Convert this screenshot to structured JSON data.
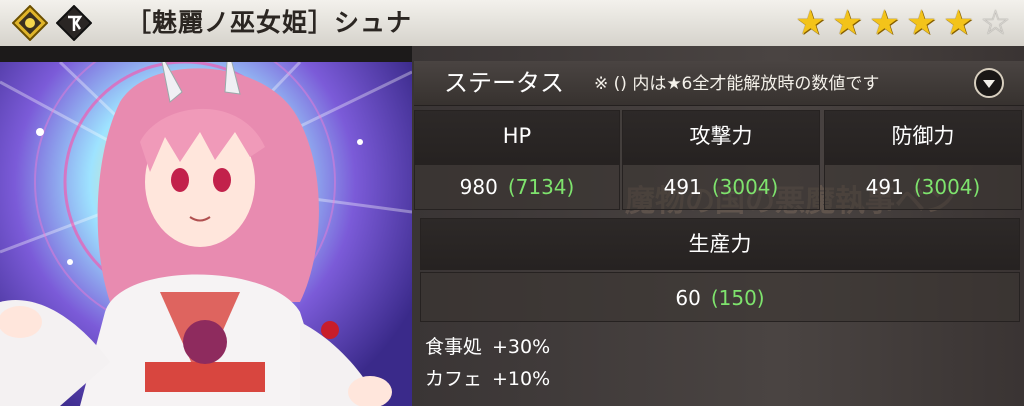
{
  "header": {
    "title": "［魅麗ノ巫女姫］シュナ",
    "rarity": 5,
    "max_rarity": 6,
    "icons": [
      "element-icon",
      "key-icon"
    ]
  },
  "status": {
    "title": "ステータス",
    "note": "※ () 内は★6全才能解放時の数値です",
    "stats": [
      {
        "label": "HP",
        "value": "980",
        "max": "(7134)"
      },
      {
        "label": "攻撃力",
        "value": "491",
        "max": "(3004)"
      },
      {
        "label": "防御力",
        "value": "491",
        "max": "(3004)"
      }
    ],
    "production": {
      "label": "生産力",
      "value": "60",
      "max": "(150)"
    }
  },
  "bonuses": [
    {
      "name": "食事処",
      "value": "+30%"
    },
    {
      "name": "カフェ",
      "value": "+10%"
    }
  ],
  "colors": {
    "star": "#f3c31a",
    "max_value": "#7ee36d"
  }
}
